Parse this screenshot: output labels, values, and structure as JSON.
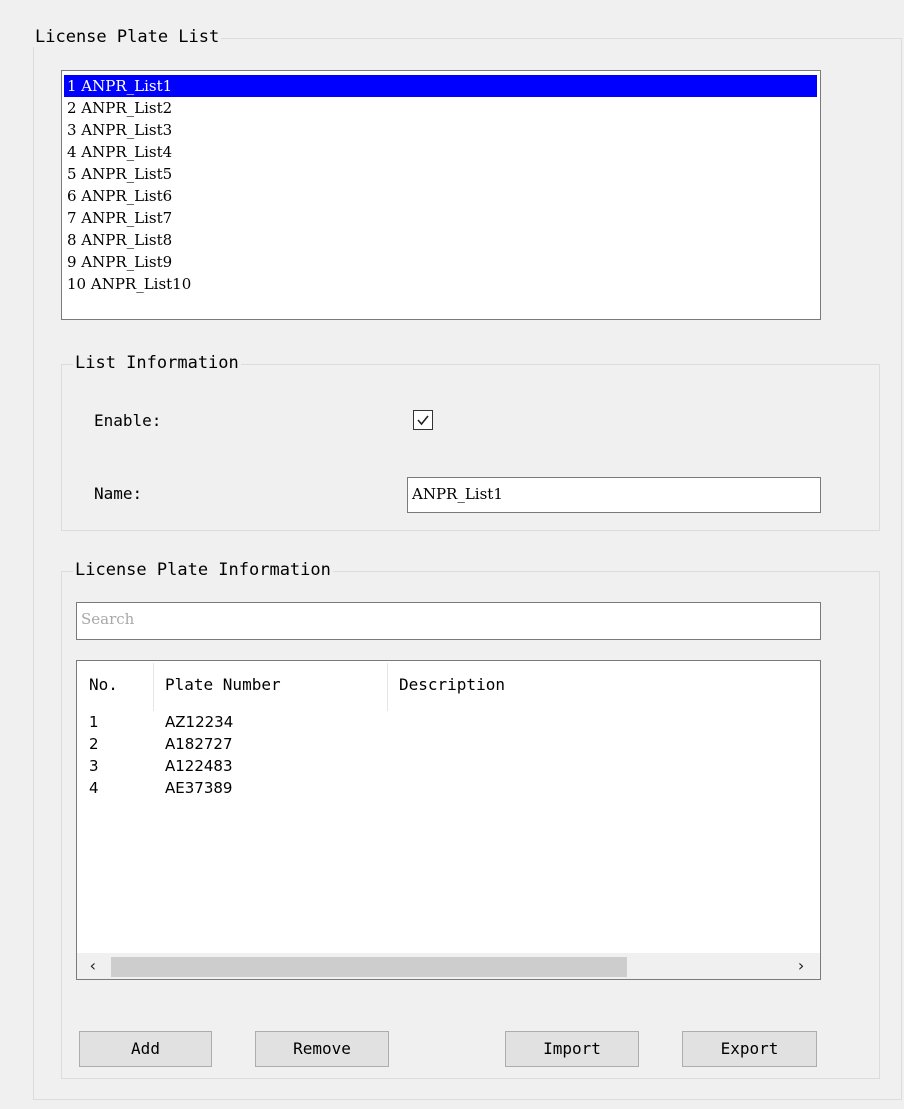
{
  "license_plate_list": {
    "title": "License Plate List",
    "items": [
      "1 ANPR_List1",
      "2 ANPR_List2",
      "3 ANPR_List3",
      "4 ANPR_List4",
      "5 ANPR_List5",
      "6 ANPR_List6",
      "7 ANPR_List7",
      "8 ANPR_List8",
      "9 ANPR_List9",
      "10 ANPR_List10"
    ],
    "selected_index": 0
  },
  "list_information": {
    "title": "List Information",
    "enable_label": "Enable:",
    "enable_checked": true,
    "name_label": "Name:",
    "name_value": "ANPR_List1"
  },
  "plate_information": {
    "title": "License Plate Information",
    "search_placeholder": "Search",
    "columns": [
      "No.",
      "Plate Number",
      "Description"
    ],
    "rows": [
      {
        "no": "1",
        "plate": "AZ12234",
        "description": ""
      },
      {
        "no": "2",
        "plate": "A182727",
        "description": ""
      },
      {
        "no": "3",
        "plate": "A122483",
        "description": ""
      },
      {
        "no": "4",
        "plate": "AE37389",
        "description": ""
      }
    ],
    "scroll_left_icon": "chevron-left-icon",
    "scroll_right_icon": "chevron-right-icon"
  },
  "buttons": {
    "add": "Add",
    "remove": "Remove",
    "import": "Import",
    "export": "Export"
  },
  "colors": {
    "selection": "#0000ff",
    "background": "#f0f0f0"
  }
}
